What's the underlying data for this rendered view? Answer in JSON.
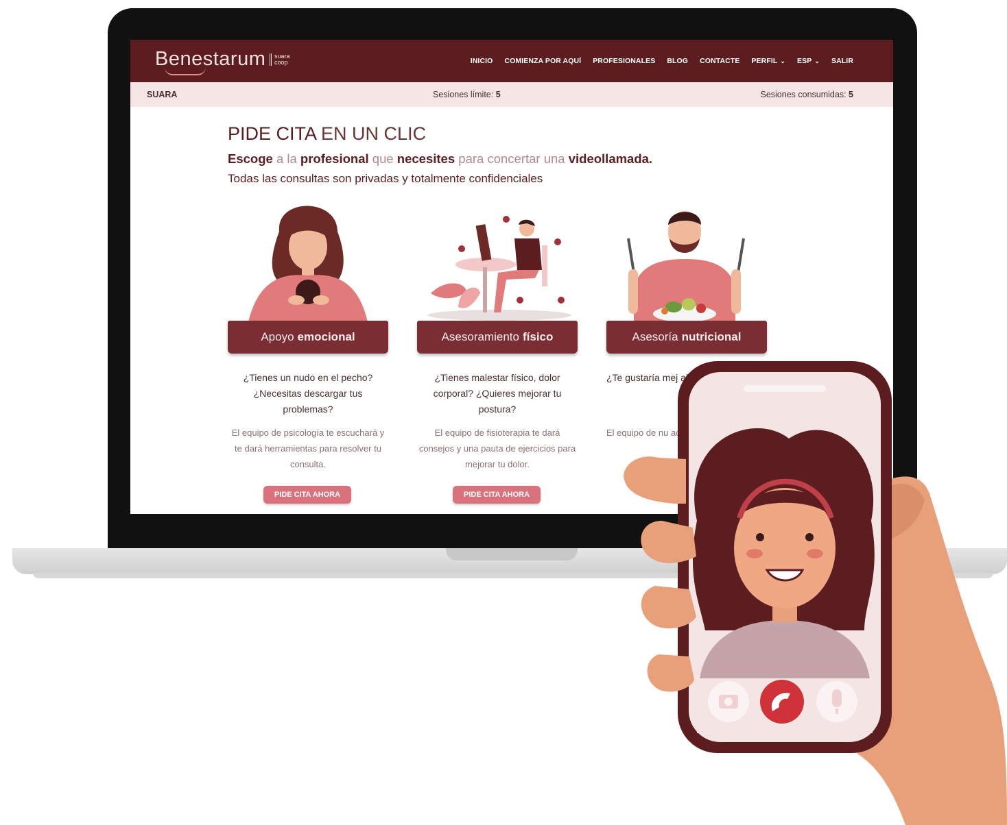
{
  "nav": {
    "logo": "Benestarum",
    "logo_sub_1": "suara",
    "logo_sub_2": "coop",
    "items": [
      {
        "label": "INICIO",
        "dropdown": false
      },
      {
        "label": "COMIENZA POR AQUÍ",
        "dropdown": false
      },
      {
        "label": "PROFESIONALES",
        "dropdown": false
      },
      {
        "label": "BLOG",
        "dropdown": false
      },
      {
        "label": "CONTACTE",
        "dropdown": false
      },
      {
        "label": "PERFIL",
        "dropdown": true
      },
      {
        "label": "ESP",
        "dropdown": true
      },
      {
        "label": "SALIR",
        "dropdown": false
      }
    ]
  },
  "subbar": {
    "org": "SUARA",
    "limit_label": "Sesiones límite:",
    "limit_value": "5",
    "consumed_label": "Sesiones consumidas:",
    "consumed_value": "5"
  },
  "hero": {
    "title_bold": "PIDE CITA",
    "title_light": "EN UN CLIC",
    "sub_parts": [
      "Escoge",
      "a la",
      "profesional",
      "que",
      "necesites",
      "para concertar una",
      "videollamada."
    ],
    "sub2": "Todas las consultas son privadas y totalmente confidenciales"
  },
  "cards": [
    {
      "tab_light": "Apoyo",
      "tab_bold": "emocional",
      "question": "¿Tienes un nudo en el pecho? ¿Necesitas descargar tus problemas?",
      "description": "El equipo de psicología te escuchará y te dará herramientas para resolver tu consulta.",
      "button": "PIDE CITA AHORA"
    },
    {
      "tab_light": "Asesoramiento",
      "tab_bold": "físico",
      "question": "¿Tienes malestar físico, dolor corporal? ¿Quieres mejorar tu postura?",
      "description": "El equipo de fisioterapia te dará consejos y una pauta de ejercicios para mejorar tu dolor.",
      "button": "PIDE CITA AHORA"
    },
    {
      "tab_light": "Asesoría",
      "tab_bold": "nutricional",
      "question": "¿Te gustaría mej alime",
      "description": "El equipo de nu aconsejará y procesc",
      "button": ""
    }
  ],
  "phone": {
    "icons": [
      "camera-icon",
      "hang-up-icon",
      "microphone-icon"
    ]
  },
  "colors": {
    "brand_dark": "#5c1d20",
    "tab": "#7a2e33",
    "button": "#d9727c",
    "subbar_bg": "#f5e5e5"
  }
}
